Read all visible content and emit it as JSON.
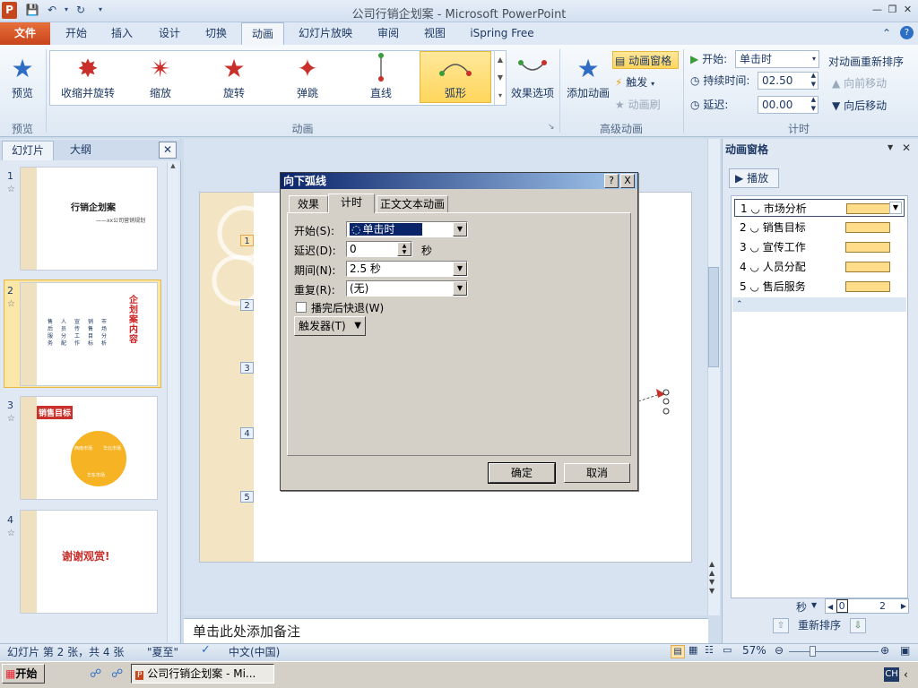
{
  "titlebar": {
    "title": "公司行销企划案 - Microsoft PowerPoint",
    "app_logo": "P"
  },
  "tabs": {
    "file": "文件",
    "home": "开始",
    "insert": "插入",
    "design": "设计",
    "transitions": "切换",
    "animations": "动画",
    "slideshow": "幻灯片放映",
    "review": "审阅",
    "view": "视图",
    "ispring": "iSpring Free"
  },
  "ribbon": {
    "preview": "预览",
    "preview_group": "预览",
    "effects": [
      "收缩并旋转",
      "缩放",
      "旋转",
      "弹跳",
      "直线",
      "弧形"
    ],
    "effect_options": "效果选项",
    "animation_group": "动画",
    "add_animation": "添加动画",
    "animation_pane": "动画窗格",
    "trigger": "触发",
    "animation_painter": "动画刷",
    "advanced_group": "高级动画",
    "start_label": "开始:",
    "start_value": "单击时",
    "duration_label": "持续时间:",
    "duration_value": "02.50",
    "delay_label": "延迟:",
    "delay_value": "00.00",
    "reorder_title": "对动画重新排序",
    "move_earlier": "向前移动",
    "move_later": "向后移动",
    "timing_group": "计时"
  },
  "left_panel": {
    "tab_slides": "幻灯片",
    "tab_outline": "大纲",
    "slides": [
      {
        "num": "1",
        "title": "行销企划案",
        "subtitle": "——xx公司营销规划"
      },
      {
        "num": "2",
        "title": "企划案内容",
        "items": [
          "市场分析",
          "销售目标",
          "宣传工作",
          "人员分配",
          "售后服务"
        ]
      },
      {
        "num": "3",
        "title": "销售目标",
        "segments": [
          "西南市场",
          "华北市场",
          "华东市场"
        ]
      },
      {
        "num": "4",
        "title": "谢谢观赏!"
      }
    ]
  },
  "slide_tags": [
    "1",
    "2",
    "3",
    "4",
    "5"
  ],
  "notes": "单击此处添加备注",
  "dialog": {
    "title": "向下弧线",
    "help": "?",
    "close": "X",
    "tabs": [
      "效果",
      "计时",
      "正文文本动画"
    ],
    "start_label": "开始(S):",
    "start_value": "单击时",
    "delay_label": "延迟(D):",
    "delay_value": "0",
    "delay_unit": "秒",
    "period_label": "期间(N):",
    "period_value": "2.5 秒",
    "repeat_label": "重复(R):",
    "repeat_value": "(无)",
    "rewind_label": "播完后快退(W)",
    "trigger_label": "触发器(T)",
    "ok": "确定",
    "cancel": "取消"
  },
  "animation_pane": {
    "title": "动画窗格",
    "play": "播放",
    "items": [
      {
        "num": "1",
        "name": "市场分析"
      },
      {
        "num": "2",
        "name": "销售目标"
      },
      {
        "num": "3",
        "name": "宣传工作"
      },
      {
        "num": "4",
        "name": "人员分配"
      },
      {
        "num": "5",
        "name": "售后服务"
      }
    ],
    "seconds": "秒",
    "timeline_start": "0",
    "timeline_end": "2",
    "reorder": "重新排序"
  },
  "status": {
    "slide_info": "幻灯片 第 2 张，共 4 张",
    "theme": "\"夏至\"",
    "language": "中文(中国)",
    "zoom": "57%"
  },
  "taskbar": {
    "start": "开始",
    "window": "公司行销企划案 - Mi...",
    "ime": "CH"
  }
}
